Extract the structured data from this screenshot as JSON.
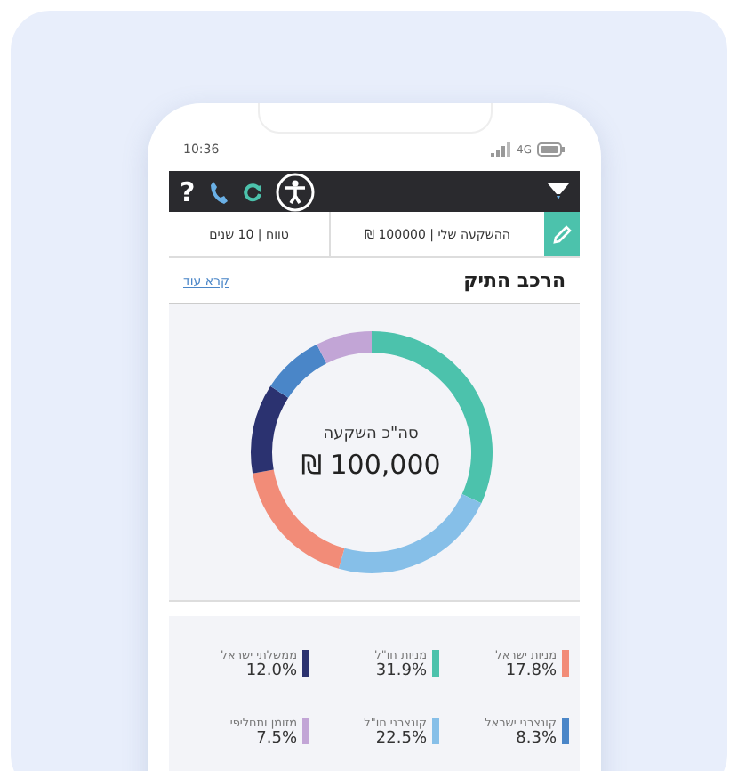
{
  "status_bar": {
    "time": "10:36",
    "network": "4G"
  },
  "toolbar": {
    "help": "?"
  },
  "info_row": {
    "investment": "ההשקעה שלי | 100000 ₪",
    "range": "טווח | 10 שנים"
  },
  "section": {
    "title": "הרכב התיק",
    "link": "קרא עוד"
  },
  "donut": {
    "center_label": "סה\"כ השקעה",
    "center_value": "100,000 ₪",
    "chart_data": {
      "type": "donut",
      "categories": [
        "מניות חו\"ל",
        "קונצרני חו\"ל",
        "מניות ישראל",
        "ממשלתי ישראל",
        "קונצרני ישראל",
        "מזומן ותחליפי"
      ],
      "values": [
        31.9,
        22.5,
        17.8,
        12.0,
        8.3,
        7.5
      ],
      "value_labels": [
        "31.9%",
        "22.5%",
        "17.8%",
        "12.0%",
        "8.3%",
        "7.5%"
      ],
      "legend": "bottom",
      "colors": [
        "#4cc2ac",
        "#86bfe8",
        "#f28c78",
        "#2b3270",
        "#4a86c8",
        "#c2a5d6"
      ]
    }
  }
}
